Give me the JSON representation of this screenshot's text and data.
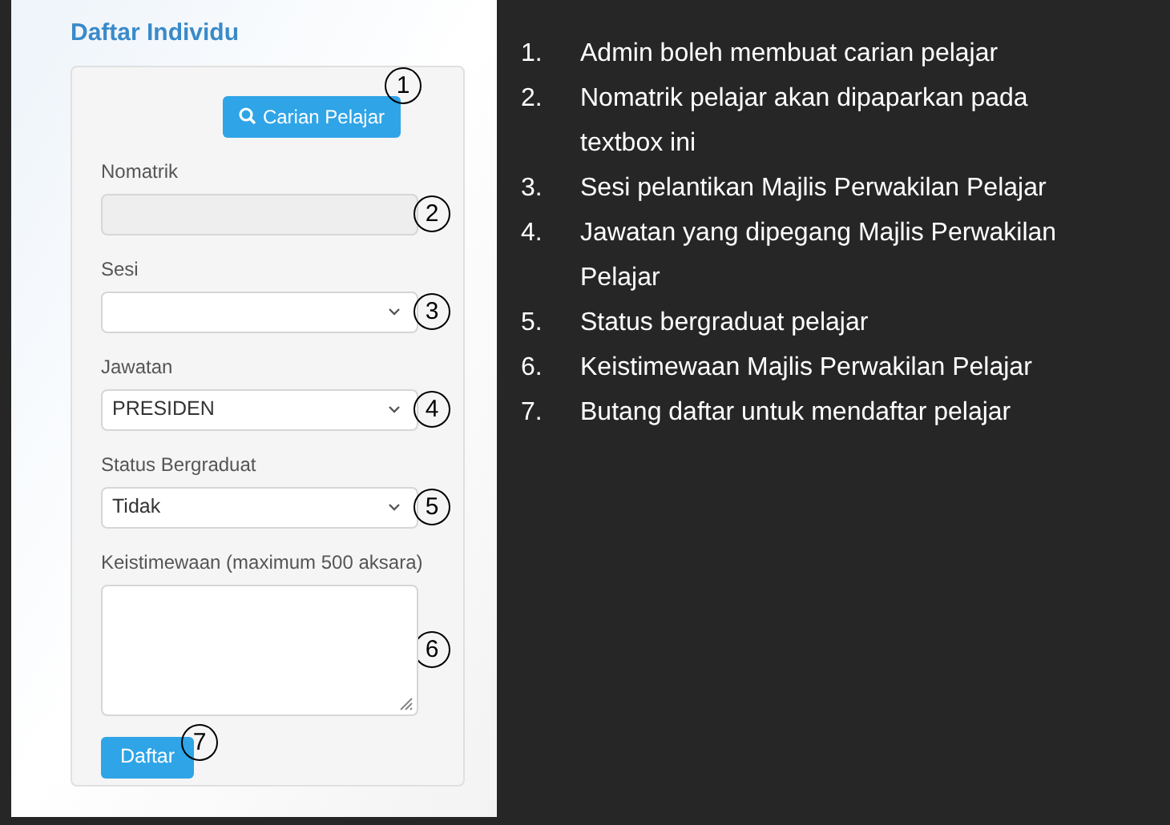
{
  "form": {
    "title": "Daftar Individu",
    "search_button": {
      "label": "Carian Pelajar",
      "callout": "1"
    },
    "fields": [
      {
        "kind": "text",
        "label": "Nomatrik",
        "disabled": true,
        "callout": "2"
      },
      {
        "kind": "select",
        "label": "Sesi",
        "callout": "3"
      },
      {
        "kind": "select",
        "label": "Jawatan",
        "value": "PRESIDEN",
        "callout": "4"
      },
      {
        "kind": "select",
        "label": "Status Bergraduat",
        "value": "Tidak",
        "callout": "5"
      },
      {
        "kind": "textarea",
        "label": "Keistimewaan (maximum 500 aksara)",
        "callout": "6"
      }
    ],
    "submit_button": {
      "label": "Daftar",
      "callout": "7"
    }
  },
  "notes": [
    {
      "number": "1.",
      "text": "Admin boleh membuat carian pelajar"
    },
    {
      "number": "2.",
      "text": "Nomatrik pelajar akan dipaparkan pada textbox ini"
    },
    {
      "number": "3.",
      "text": "Sesi pelantikan Majlis Perwakilan Pelajar"
    },
    {
      "number": "4.",
      "text": "Jawatan yang dipegang Majlis Perwakilan Pelajar"
    },
    {
      "number": "5.",
      "text": "Status bergraduat pelajar"
    },
    {
      "number": "6.",
      "text": "Keistimewaan Majlis Perwakilan Pelajar"
    },
    {
      "number": "7.",
      "text": "Butang daftar untuk mendaftar pelajar"
    }
  ]
}
